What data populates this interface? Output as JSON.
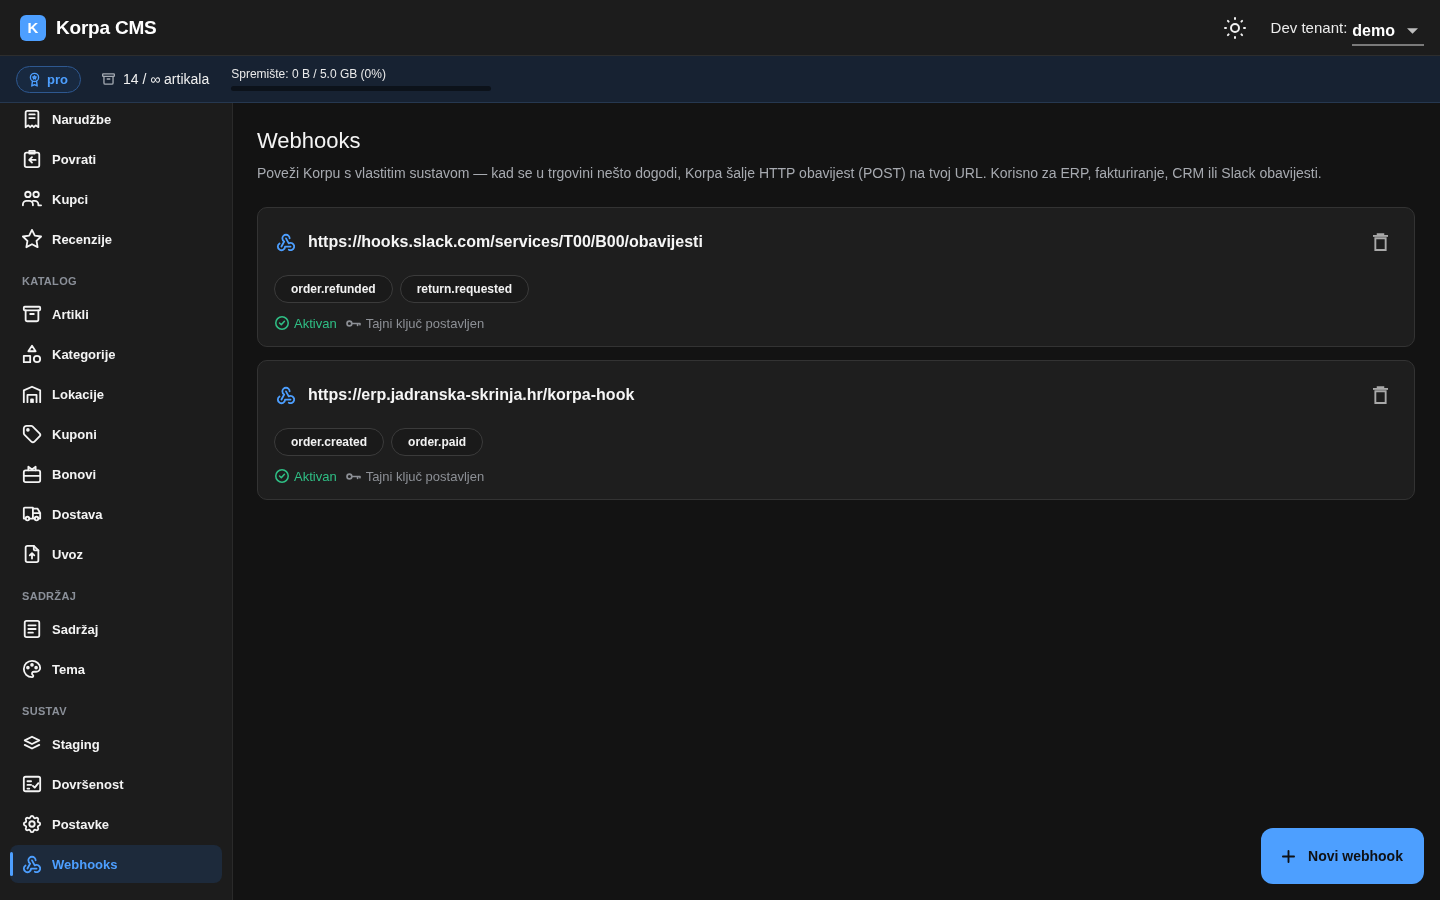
{
  "app": {
    "logo_letter": "K",
    "name": "Korpa CMS"
  },
  "tenant": {
    "label": "Dev tenant:",
    "value": "demo"
  },
  "plan_bar": {
    "plan": "pro",
    "items": "14 / ∞ artikala",
    "storage": {
      "label": "Spremište: 0 B / 5.0 GB (0%)",
      "level": 0
    }
  },
  "sidebar": {
    "sections": [
      {
        "items": [
          {
            "label": "Narudžbe",
            "selected": false
          },
          {
            "label": "Povrati",
            "selected": false
          },
          {
            "label": "Kupci",
            "selected": false
          },
          {
            "label": "Recenzije",
            "selected": false
          }
        ]
      },
      {
        "title": "KATALOG",
        "items": [
          {
            "label": "Artikli",
            "selected": false
          },
          {
            "label": "Kategorije",
            "selected": false
          },
          {
            "label": "Lokacije",
            "selected": false
          },
          {
            "label": "Kuponi",
            "selected": false
          },
          {
            "label": "Bonovi",
            "selected": false
          },
          {
            "label": "Dostava",
            "selected": false
          },
          {
            "label": "Uvoz",
            "selected": false
          }
        ]
      },
      {
        "title": "SADRŽAJ",
        "items": [
          {
            "label": "Sadržaj",
            "selected": false
          },
          {
            "label": "Tema",
            "selected": false
          }
        ]
      },
      {
        "title": "SUSTAV",
        "items": [
          {
            "label": "Staging",
            "selected": false
          },
          {
            "label": "Dovršenost",
            "selected": false
          },
          {
            "label": "Postavke",
            "selected": false
          },
          {
            "label": "Webhooks",
            "selected": true
          }
        ]
      }
    ]
  },
  "page": {
    "title": "Webhooks",
    "description": "Poveži Korpu s vlastitim sustavom — kad se u trgovini nešto dogodi, Korpa šalje HTTP obavijest (POST) na tvoj URL. Korisno za ERP, fakturiranje, CRM ili Slack obavijesti."
  },
  "webhooks": [
    {
      "url": "https://hooks.slack.com/services/T00/B00/obavijesti",
      "events": [
        "order.refunded",
        "return.requested"
      ],
      "status": {
        "label": "Aktivan",
        "active": true
      },
      "secret": "Tajni ključ postavljen"
    },
    {
      "url": "https://erp.jadranska-skrinja.hr/korpa-hook",
      "events": [
        "order.created",
        "order.paid"
      ],
      "status": {
        "label": "Aktivan",
        "active": true
      },
      "secret": "Tajni ključ postavljen"
    }
  ],
  "new_button": {
    "label": "Novi webhook"
  }
}
